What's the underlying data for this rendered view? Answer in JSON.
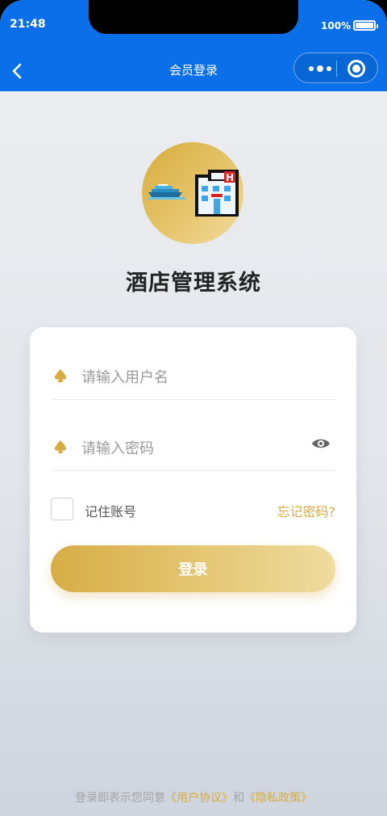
{
  "status_bar": {
    "time": "21:48",
    "battery": "100%"
  },
  "nav": {
    "title": "会员登录"
  },
  "app": {
    "title": "酒店管理系统"
  },
  "form": {
    "username_placeholder": "请输入用户名",
    "password_placeholder": "请输入密码",
    "remember_label": "记住账号",
    "forgot_label": "忘记密码?",
    "login_label": "登录"
  },
  "footer": {
    "prefix": "登录即表示您同意",
    "agreement": "《用户协议》",
    "and": "和",
    "privacy": "《隐私政策》"
  },
  "colors": {
    "nav_blue": "#0a6fe8",
    "accent_gold": "#d8ab3e"
  },
  "icons": {
    "back": "chevron-left-icon",
    "more": "more-dots-icon",
    "close": "target-circle-icon",
    "user": "spade-icon",
    "lock": "spade-icon",
    "eye": "eye-icon",
    "logo": "hotel-icon"
  }
}
